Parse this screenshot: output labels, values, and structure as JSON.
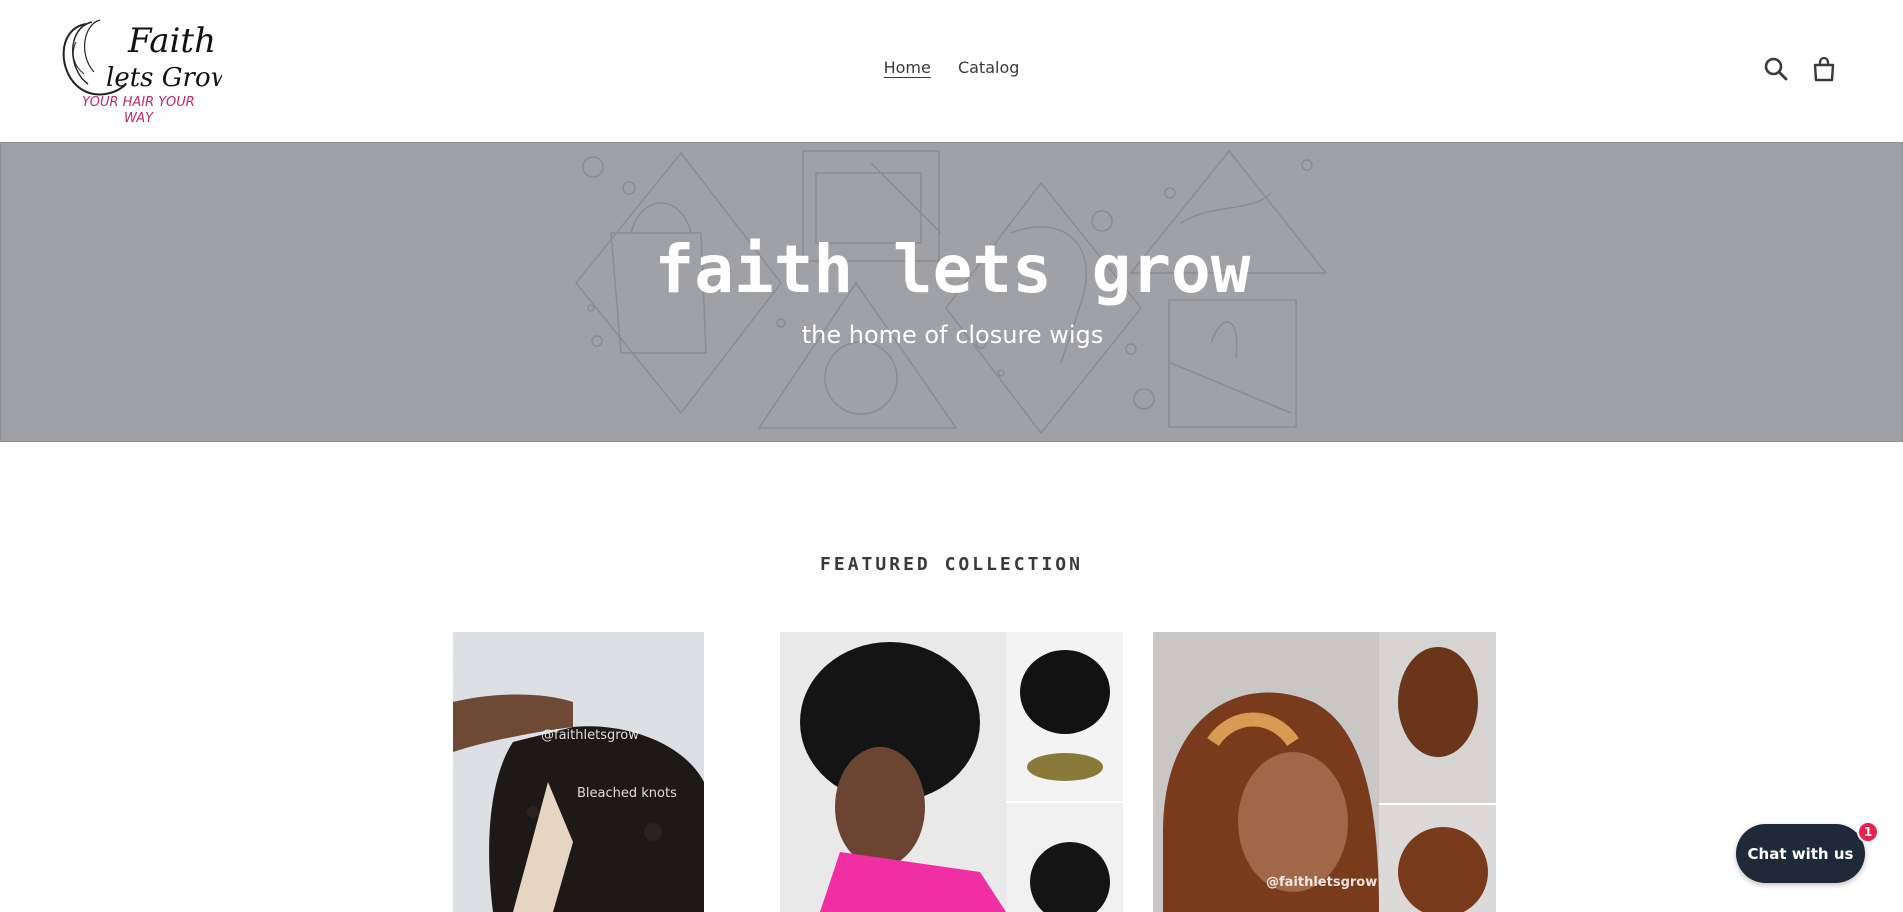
{
  "header": {
    "logo": {
      "brand_line1": "Faith",
      "brand_line2": "lets Grow",
      "tagline_line1": "YOUR HAIR YOUR",
      "tagline_line2": "WAY",
      "accent_color": "#c2266e"
    },
    "nav": [
      {
        "label": "Home",
        "active": true
      },
      {
        "label": "Catalog",
        "active": false
      }
    ],
    "icons": [
      "search-icon",
      "cart-icon"
    ]
  },
  "hero": {
    "title": "faith lets grow",
    "subtitle": "the home of closure wigs",
    "overlay_color": "#9fa1a6"
  },
  "featured": {
    "title": "FEATURED COLLECTION",
    "products": [
      {
        "watermark": "@faithletsgrow",
        "caption": "Bleached knots"
      },
      {
        "watermark": ""
      },
      {
        "watermark": "@faithletsgrow"
      }
    ]
  },
  "chat": {
    "label": "Chat with us",
    "badge_count": "1",
    "color": "#1f2a38",
    "badge_color": "#e8214e"
  }
}
